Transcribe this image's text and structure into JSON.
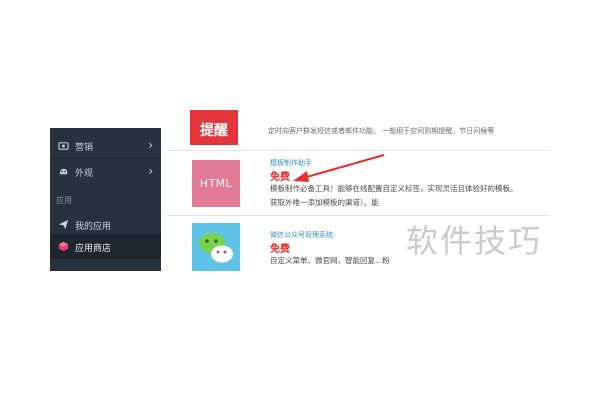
{
  "sidebar": {
    "items": [
      {
        "label": "营销",
        "icon": "megaphone-icon"
      },
      {
        "label": "外观",
        "icon": "palette-icon"
      }
    ],
    "section_label": "应用",
    "section_items": [
      {
        "label": "我的应用",
        "icon": "paper-plane-icon"
      },
      {
        "label": "应用商店",
        "icon": "cube-icon",
        "active": true
      }
    ]
  },
  "list": {
    "top_row": {
      "badge_text": "提醒",
      "desc_partial": "定时向客户群发短信或者邮件功能。   一般用于空间到期提醒，节日问候等"
    },
    "apps": [
      {
        "name": "模板制作助手",
        "price": "免费",
        "thumb_text": "HTML",
        "desc_line1": "模板制作必备工具！能够在线配置自定义标签，实现灵活且体验好的模板。",
        "desc_line2": "获取外唯一添加模板的渠道）。能"
      },
      {
        "name": "微信公众号管理系统",
        "price": "免费",
        "desc_line1": "自定义菜单、微官网、智能回复...粉"
      }
    ]
  },
  "watermark": "软件技巧",
  "colors": {
    "sidebar_bg": "#27323c",
    "price_red": "#e0312f",
    "link_blue": "#3c8fc4",
    "html_thumb": "#e07a97",
    "wechat_thumb": "#5ec3e6",
    "arrow": "#e0312f"
  }
}
